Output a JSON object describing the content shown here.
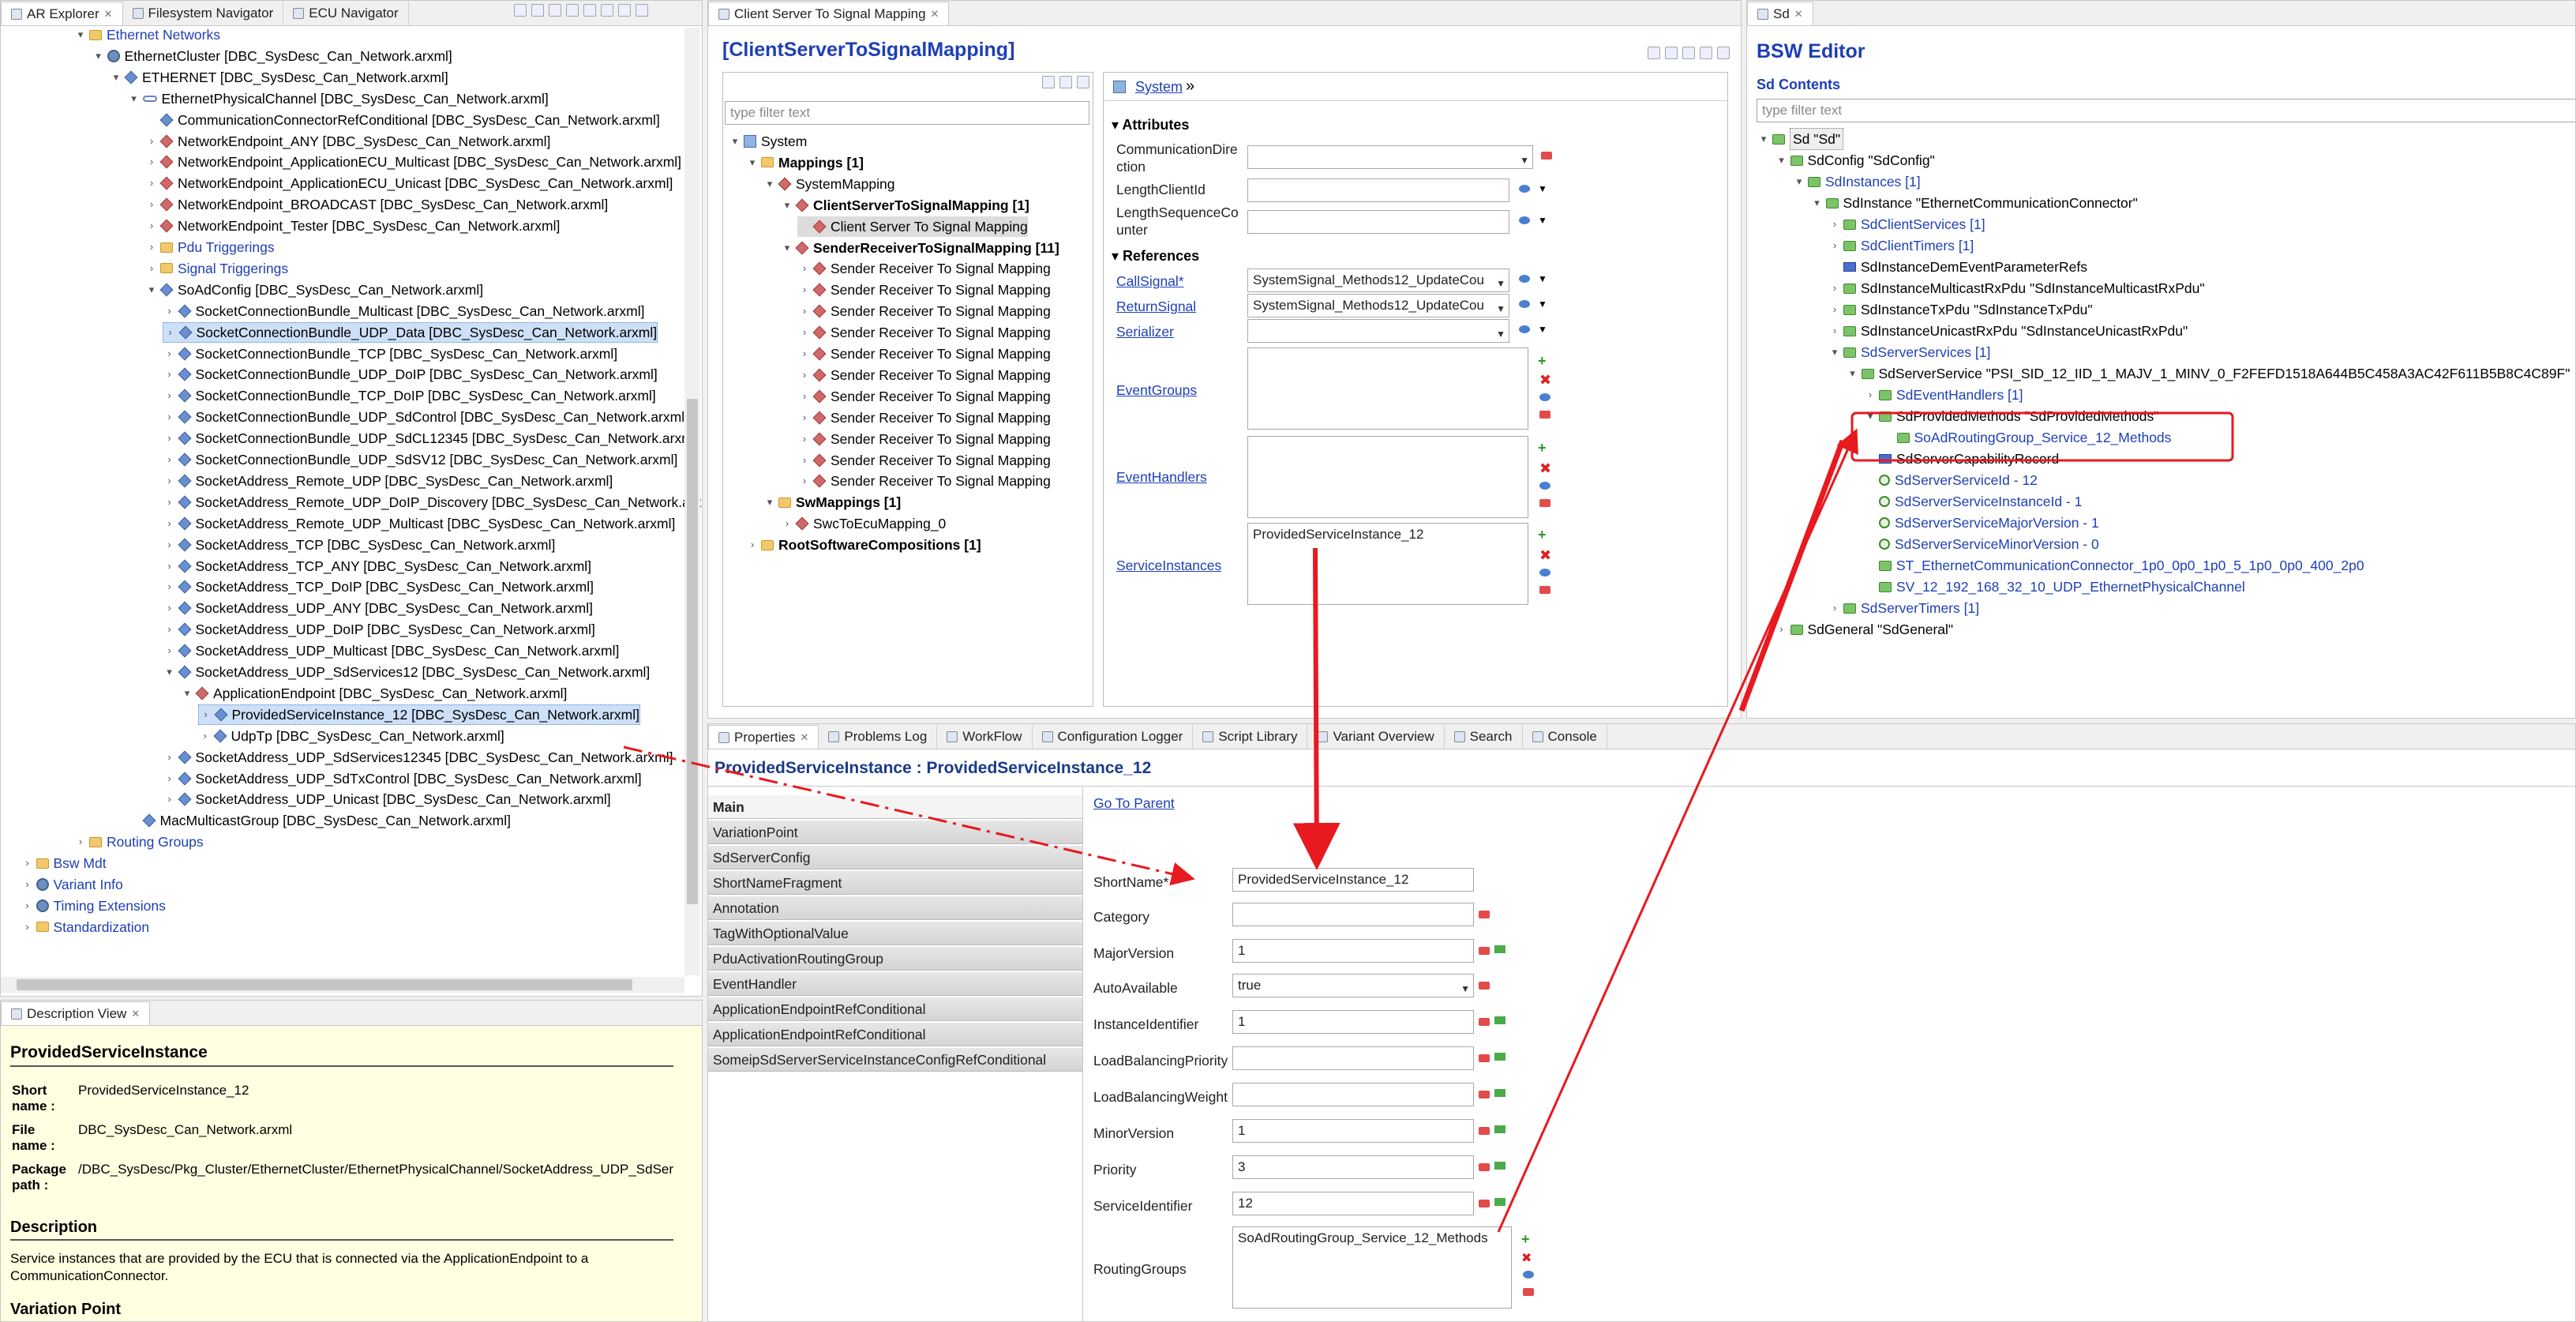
{
  "left_tabs": {
    "ar_explorer": "AR Explorer",
    "fs_nav": "Filesystem Navigator",
    "ecu_nav": "ECU Navigator"
  },
  "left_tree": [
    {
      "t": "Ethernet Networks",
      "ind": 4,
      "tw": "v",
      "ic": "folder",
      "link": true
    },
    {
      "t": "EthernetCluster [DBC_SysDesc_Can_Network.arxml]",
      "ind": 5,
      "tw": "v",
      "ic": "gear"
    },
    {
      "t": "ETHERNET [DBC_SysDesc_Can_Network.arxml]",
      "ind": 6,
      "tw": "v",
      "ic": "dia"
    },
    {
      "t": "EthernetPhysicalChannel [DBC_SysDesc_Can_Network.arxml]",
      "ind": 7,
      "tw": "v",
      "ic": "chain"
    },
    {
      "t": "CommunicationConnectorRefConditional [DBC_SysDesc_Can_Network.arxml]",
      "ind": 8,
      "tw": "",
      "ic": "dia"
    },
    {
      "t": "NetworkEndpoint_ANY [DBC_SysDesc_Can_Network.arxml]",
      "ind": 8,
      "tw": ">",
      "ic": "diar"
    },
    {
      "t": "NetworkEndpoint_ApplicationECU_Multicast [DBC_SysDesc_Can_Network.arxml]",
      "ind": 8,
      "tw": ">",
      "ic": "diar"
    },
    {
      "t": "NetworkEndpoint_ApplicationECU_Unicast [DBC_SysDesc_Can_Network.arxml]",
      "ind": 8,
      "tw": ">",
      "ic": "diar"
    },
    {
      "t": "NetworkEndpoint_BROADCAST [DBC_SysDesc_Can_Network.arxml]",
      "ind": 8,
      "tw": ">",
      "ic": "diar"
    },
    {
      "t": "NetworkEndpoint_Tester [DBC_SysDesc_Can_Network.arxml]",
      "ind": 8,
      "tw": ">",
      "ic": "diar"
    },
    {
      "t": "Pdu Triggerings",
      "ind": 8,
      "tw": ">",
      "ic": "folder",
      "link": true
    },
    {
      "t": "Signal Triggerings",
      "ind": 8,
      "tw": ">",
      "ic": "folder",
      "link": true
    },
    {
      "t": "SoAdConfig [DBC_SysDesc_Can_Network.arxml]",
      "ind": 8,
      "tw": "v",
      "ic": "dia"
    },
    {
      "t": "SocketConnectionBundle_Multicast [DBC_SysDesc_Can_Network.arxml]",
      "ind": 9,
      "tw": ">",
      "ic": "dia"
    },
    {
      "t": "SocketConnectionBundle_UDP_Data [DBC_SysDesc_Can_Network.arxml]",
      "ind": 9,
      "tw": ">",
      "ic": "dia",
      "hl": "sel"
    },
    {
      "t": "SocketConnectionBundle_TCP [DBC_SysDesc_Can_Network.arxml]",
      "ind": 9,
      "tw": ">",
      "ic": "dia"
    },
    {
      "t": "SocketConnectionBundle_UDP_DoIP [DBC_SysDesc_Can_Network.arxml]",
      "ind": 9,
      "tw": ">",
      "ic": "dia"
    },
    {
      "t": "SocketConnectionBundle_TCP_DoIP [DBC_SysDesc_Can_Network.arxml]",
      "ind": 9,
      "tw": ">",
      "ic": "dia"
    },
    {
      "t": "SocketConnectionBundle_UDP_SdControl [DBC_SysDesc_Can_Network.arxml]",
      "ind": 9,
      "tw": ">",
      "ic": "dia"
    },
    {
      "t": "SocketConnectionBundle_UDP_SdCL12345 [DBC_SysDesc_Can_Network.arxml]",
      "ind": 9,
      "tw": ">",
      "ic": "dia"
    },
    {
      "t": "SocketConnectionBundle_UDP_SdSV12 [DBC_SysDesc_Can_Network.arxml]",
      "ind": 9,
      "tw": ">",
      "ic": "dia"
    },
    {
      "t": "SocketAddress_Remote_UDP [DBC_SysDesc_Can_Network.arxml]",
      "ind": 9,
      "tw": ">",
      "ic": "dia"
    },
    {
      "t": "SocketAddress_Remote_UDP_DoIP_Discovery [DBC_SysDesc_Can_Network.arxml]",
      "ind": 9,
      "tw": ">",
      "ic": "dia"
    },
    {
      "t": "SocketAddress_Remote_UDP_Multicast [DBC_SysDesc_Can_Network.arxml]",
      "ind": 9,
      "tw": ">",
      "ic": "dia"
    },
    {
      "t": "SocketAddress_TCP [DBC_SysDesc_Can_Network.arxml]",
      "ind": 9,
      "tw": ">",
      "ic": "dia"
    },
    {
      "t": "SocketAddress_TCP_ANY [DBC_SysDesc_Can_Network.arxml]",
      "ind": 9,
      "tw": ">",
      "ic": "dia"
    },
    {
      "t": "SocketAddress_TCP_DoIP [DBC_SysDesc_Can_Network.arxml]",
      "ind": 9,
      "tw": ">",
      "ic": "dia"
    },
    {
      "t": "SocketAddress_UDP_ANY [DBC_SysDesc_Can_Network.arxml]",
      "ind": 9,
      "tw": ">",
      "ic": "dia"
    },
    {
      "t": "SocketAddress_UDP_DoIP [DBC_SysDesc_Can_Network.arxml]",
      "ind": 9,
      "tw": ">",
      "ic": "dia"
    },
    {
      "t": "SocketAddress_UDP_Multicast [DBC_SysDesc_Can_Network.arxml]",
      "ind": 9,
      "tw": ">",
      "ic": "dia"
    },
    {
      "t": "SocketAddress_UDP_SdServices12 [DBC_SysDesc_Can_Network.arxml]",
      "ind": 9,
      "tw": "v",
      "ic": "dia"
    },
    {
      "t": "ApplicationEndpoint [DBC_SysDesc_Can_Network.arxml]",
      "ind": 10,
      "tw": "v",
      "ic": "diar"
    },
    {
      "t": "ProvidedServiceInstance_12 [DBC_SysDesc_Can_Network.arxml]",
      "ind": 11,
      "tw": ">",
      "ic": "dia",
      "hl": "sel"
    },
    {
      "t": "UdpTp [DBC_SysDesc_Can_Network.arxml]",
      "ind": 11,
      "tw": ">",
      "ic": "dia"
    },
    {
      "t": "SocketAddress_UDP_SdServices12345 [DBC_SysDesc_Can_Network.arxml]",
      "ind": 9,
      "tw": ">",
      "ic": "dia"
    },
    {
      "t": "SocketAddress_UDP_SdTxControl [DBC_SysDesc_Can_Network.arxml]",
      "ind": 9,
      "tw": ">",
      "ic": "dia"
    },
    {
      "t": "SocketAddress_UDP_Unicast [DBC_SysDesc_Can_Network.arxml]",
      "ind": 9,
      "tw": ">",
      "ic": "dia"
    },
    {
      "t": "MacMulticastGroup [DBC_SysDesc_Can_Network.arxml]",
      "ind": 7,
      "tw": "",
      "ic": "dia"
    },
    {
      "t": "Routing Groups",
      "ind": 4,
      "tw": ">",
      "ic": "folder",
      "link": true
    },
    {
      "t": "Bsw Mdt",
      "ind": 1,
      "tw": ">",
      "ic": "folder",
      "link": true
    },
    {
      "t": "Variant Info",
      "ind": 1,
      "tw": ">",
      "ic": "gear",
      "link": true
    },
    {
      "t": "Timing Extensions",
      "ind": 1,
      "tw": ">",
      "ic": "gear",
      "link": true
    },
    {
      "t": "Standardization",
      "ind": 1,
      "tw": ">",
      "ic": "folder",
      "link": true
    }
  ],
  "desc_view": {
    "tab": "Description View",
    "title": "ProvidedServiceInstance",
    "short_name_label": "Short name :",
    "short_name": "ProvidedServiceInstance_12",
    "file_name_label": "File name :",
    "file_name": "DBC_SysDesc_Can_Network.arxml",
    "package_label": "Package path :",
    "package_path": "/DBC_SysDesc/Pkg_Cluster/EthernetCluster/EthernetPhysicalChannel/SocketAddress_UDP_SdSer",
    "desc_heading": "Description",
    "desc_text": "Service instances that are provided by the ECU that is connected via the ApplicationEndpoint to a CommunicationConnector.",
    "vp_heading": "Variation Point"
  },
  "cstsm": {
    "tab": "Client Server To Signal Mapping",
    "title": "[ClientServerToSignalMapping]",
    "filter_placeholder": "type filter text",
    "tree": [
      {
        "t": "System",
        "ind": 0,
        "tw": "v",
        "ic": "pkg",
        "b": false
      },
      {
        "t": "Mappings [1]",
        "ind": 1,
        "tw": "v",
        "ic": "folder",
        "b": true
      },
      {
        "t": "SystemMapping",
        "ind": 2,
        "tw": "v",
        "ic": "diar",
        "b": false
      },
      {
        "t": "ClientServerToSignalMapping [1]",
        "ind": 3,
        "tw": "v",
        "ic": "diar",
        "b": true
      },
      {
        "t": "Client Server To Signal Mapping",
        "ind": 4,
        "tw": "",
        "ic": "diar",
        "b": false,
        "hl": "gsel"
      },
      {
        "t": "SenderReceiverToSignalMapping [11]",
        "ind": 3,
        "tw": "v",
        "ic": "diar",
        "b": true
      },
      {
        "t": "Sender Receiver To Signal Mapping",
        "ind": 4,
        "tw": ">",
        "ic": "diar",
        "b": false
      },
      {
        "t": "Sender Receiver To Signal Mapping",
        "ind": 4,
        "tw": ">",
        "ic": "diar",
        "b": false
      },
      {
        "t": "Sender Receiver To Signal Mapping",
        "ind": 4,
        "tw": ">",
        "ic": "diar",
        "b": false
      },
      {
        "t": "Sender Receiver To Signal Mapping",
        "ind": 4,
        "tw": ">",
        "ic": "diar",
        "b": false
      },
      {
        "t": "Sender Receiver To Signal Mapping",
        "ind": 4,
        "tw": ">",
        "ic": "diar",
        "b": false
      },
      {
        "t": "Sender Receiver To Signal Mapping",
        "ind": 4,
        "tw": ">",
        "ic": "diar",
        "b": false
      },
      {
        "t": "Sender Receiver To Signal Mapping",
        "ind": 4,
        "tw": ">",
        "ic": "diar",
        "b": false
      },
      {
        "t": "Sender Receiver To Signal Mapping",
        "ind": 4,
        "tw": ">",
        "ic": "diar",
        "b": false
      },
      {
        "t": "Sender Receiver To Signal Mapping",
        "ind": 4,
        "tw": ">",
        "ic": "diar",
        "b": false
      },
      {
        "t": "Sender Receiver To Signal Mapping",
        "ind": 4,
        "tw": ">",
        "ic": "diar",
        "b": false
      },
      {
        "t": "Sender Receiver To Signal Mapping",
        "ind": 4,
        "tw": ">",
        "ic": "diar",
        "b": false
      },
      {
        "t": "SwMappings [1]",
        "ind": 2,
        "tw": "v",
        "ic": "folder",
        "b": true
      },
      {
        "t": "SwcToEcuMapping_0",
        "ind": 3,
        "tw": ">",
        "ic": "diar",
        "b": false
      },
      {
        "t": "RootSoftwareCompositions [1]",
        "ind": 1,
        "tw": ">",
        "ic": "folder",
        "b": true
      }
    ],
    "breadcrumb": "System",
    "attributes": "Attributes",
    "comm_dir_label": "CommunicationDirection",
    "length_client_label": "LengthClientId",
    "length_seq_label": "LengthSequenceCounter",
    "references": "References",
    "call_signal_label": "CallSignal*",
    "call_signal_value": "SystemSignal_Methods12_UpdateCou",
    "return_signal_label": "ReturnSignal",
    "return_signal_value": "SystemSignal_Methods12_UpdateCou",
    "serializer_label": "Serializer",
    "event_groups_label": "EventGroups",
    "event_handlers_label": "EventHandlers",
    "service_instances_label": "ServiceInstances",
    "service_instances_value": "ProvidedServiceInstance_12"
  },
  "sd": {
    "tab": "Sd",
    "title": "BSW Editor",
    "contents": "Sd Contents",
    "filter_placeholder": "type filter text",
    "tree": [
      {
        "t": "Sd \"Sd\"",
        "ind": 0,
        "tw": "v",
        "ic": "greenf",
        "link": false,
        "box": true
      },
      {
        "t": "SdConfig \"SdConfig\"",
        "ind": 1,
        "tw": "v",
        "ic": "greenf",
        "link": false
      },
      {
        "t": "SdInstances [1]",
        "ind": 2,
        "tw": "v",
        "ic": "greenf",
        "link": true
      },
      {
        "t": "SdInstance \"EthernetCommunicationConnector\"",
        "ind": 3,
        "tw": "v",
        "ic": "greenf",
        "link": false
      },
      {
        "t": "SdClientServices [1]",
        "ind": 4,
        "tw": ">",
        "ic": "greenf",
        "link": true
      },
      {
        "t": "SdClientTimers [1]",
        "ind": 4,
        "tw": ">",
        "ic": "greenf",
        "link": true
      },
      {
        "t": "SdInstanceDemEventParameterRefs",
        "ind": 4,
        "tw": "",
        "ic": "blueb",
        "link": false
      },
      {
        "t": "SdInstanceMulticastRxPdu \"SdInstanceMulticastRxPdu\"",
        "ind": 4,
        "tw": ">",
        "ic": "greenf",
        "link": false
      },
      {
        "t": "SdInstanceTxPdu \"SdInstanceTxPdu\"",
        "ind": 4,
        "tw": ">",
        "ic": "greenf",
        "link": false
      },
      {
        "t": "SdInstanceUnicastRxPdu \"SdInstanceUnicastRxPdu\"",
        "ind": 4,
        "tw": ">",
        "ic": "greenf",
        "link": false
      },
      {
        "t": "SdServerServices [1]",
        "ind": 4,
        "tw": "v",
        "ic": "greenf",
        "link": true
      },
      {
        "t": "SdServerService \"PSI_SID_12_IID_1_MAJV_1_MINV_0_F2FEFD1518A644B5C458A3AC42F611B5B8C4C89F\"",
        "ind": 5,
        "tw": "v",
        "ic": "greenf",
        "link": false
      },
      {
        "t": "SdEventHandlers [1]",
        "ind": 6,
        "tw": ">",
        "ic": "greenf",
        "link": true
      },
      {
        "t": "SdProvidedMethods \"SdProvidedMethods\"",
        "ind": 6,
        "tw": "v",
        "ic": "greenf",
        "link": false
      },
      {
        "t": "SoAdRoutingGroup_Service_12_Methods",
        "ind": 7,
        "tw": "",
        "ic": "greenf",
        "link": true
      },
      {
        "t": "SdServerCapabilityRecord",
        "ind": 6,
        "tw": "",
        "ic": "blueb",
        "link": false
      },
      {
        "t": "SdServerServiceId - 12",
        "ind": 6,
        "tw": "",
        "ic": "greeng",
        "link": true
      },
      {
        "t": "SdServerServiceInstanceId - 1",
        "ind": 6,
        "tw": "",
        "ic": "greeng",
        "link": true
      },
      {
        "t": "SdServerServiceMajorVersion - 1",
        "ind": 6,
        "tw": "",
        "ic": "greeng",
        "link": true
      },
      {
        "t": "SdServerServiceMinorVersion - 0",
        "ind": 6,
        "tw": "",
        "ic": "greeng",
        "link": true
      },
      {
        "t": "ST_EthernetCommunicationConnector_1p0_0p0_1p0_5_1p0_0p0_400_2p0",
        "ind": 6,
        "tw": "",
        "ic": "greenf",
        "link": true
      },
      {
        "t": "SV_12_192_168_32_10_UDP_EthernetPhysicalChannel",
        "ind": 6,
        "tw": "",
        "ic": "greenf",
        "link": true
      },
      {
        "t": "SdServerTimers [1]",
        "ind": 4,
        "tw": ">",
        "ic": "greenf",
        "link": true
      },
      {
        "t": "SdGeneral \"SdGeneral\"",
        "ind": 1,
        "tw": ">",
        "ic": "greenf",
        "link": false
      }
    ]
  },
  "bottom_tabs": [
    "Properties",
    "Problems Log",
    "WorkFlow",
    "Configuration Logger",
    "Script Library",
    "Variant Overview",
    "Search",
    "Console"
  ],
  "props": {
    "title": "ProvidedServiceInstance : ProvidedServiceInstance_12",
    "nav": [
      "Main",
      "VariationPoint",
      "SdServerConfig",
      "ShortNameFragment",
      "Annotation",
      "TagWithOptionalValue",
      "PduActivationRoutingGroup",
      "EventHandler",
      "ApplicationEndpointRefConditional",
      "ApplicationEndpointRefConditional",
      "SomeipSdServerServiceInstanceConfigRefConditional"
    ],
    "go_to_parent": "Go To Parent",
    "short_name_label": "ShortName*",
    "short_name": "ProvidedServiceInstance_12",
    "category_label": "Category",
    "category": "",
    "major_label": "MajorVersion",
    "major": "1",
    "autoavail_label": "AutoAvailable",
    "autoavail": "true",
    "instance_label": "InstanceIdentifier",
    "instance": "1",
    "lbprio_label": "LoadBalancingPriority",
    "lbprio": "",
    "lbweight_label": "LoadBalancingWeight",
    "lbweight": "",
    "minor_label": "MinorVersion",
    "minor": "1",
    "priority_label": "Priority",
    "priority": "3",
    "serviceid_label": "ServiceIdentifier",
    "serviceid": "12",
    "routing_label": "RoutingGroups",
    "routing": "SoAdRoutingGroup_Service_12_Methods"
  },
  "colors": {
    "link": "#1e3fb4",
    "arrow": "#e8191f",
    "desc_bg": "#ffffe1"
  }
}
